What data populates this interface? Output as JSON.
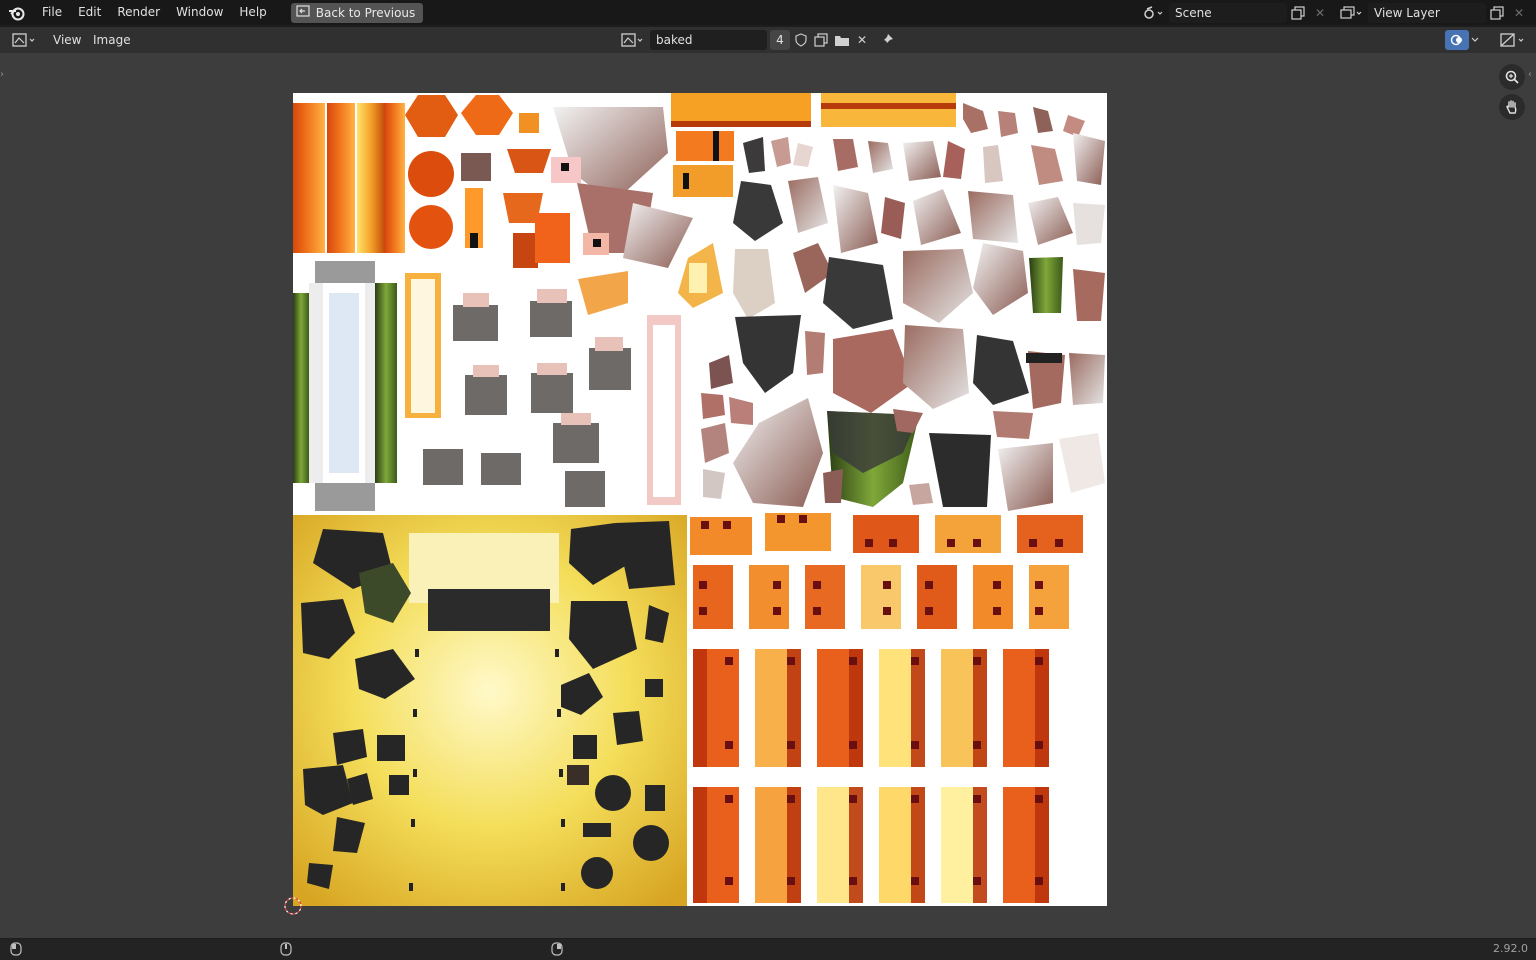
{
  "topbar": {
    "menu": [
      "File",
      "Edit",
      "Render",
      "Window",
      "Help"
    ],
    "back_button": "Back to Previous",
    "scene": "Scene",
    "view_layer": "View Layer"
  },
  "editor_header": {
    "menu": [
      "View",
      "Image"
    ],
    "image_name": "baked",
    "users_count": "4"
  },
  "statusbar": {
    "version": "2.92.0"
  },
  "icons": {
    "logo": "blender-logo-icon",
    "back": "back-icon",
    "scene": "scene-icon",
    "view_layer": "view-layer-icon",
    "zoom": "zoom-icon",
    "pan": "hand-icon"
  }
}
